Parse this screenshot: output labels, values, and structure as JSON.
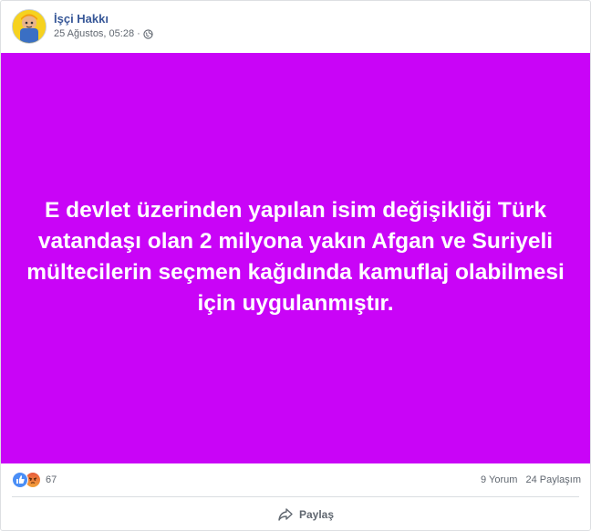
{
  "post": {
    "page_name": "İşçi Hakkı",
    "date": "25 Ağustos, 05:28",
    "separator": "·",
    "privacy_icon": "globe-icon",
    "avatar_icon": "cartoon-worker-avatar"
  },
  "media": {
    "background_color": "#c904f7",
    "text": "E devlet üzerinden yapılan isim değişikliği Türk vatandaşı olan 2 milyona yakın Afgan ve Suriyeli mültecilerin seçmen kağıdında kamuflaj olabilmesi için uygulanmıştır."
  },
  "stats": {
    "reaction_icons": [
      "like-icon",
      "angry-icon"
    ],
    "reaction_count": "67",
    "comments": "9 Yorum",
    "shares": "24 Paylaşım"
  },
  "actions": {
    "share_label": "Paylaş",
    "share_icon": "share-arrow-icon"
  }
}
